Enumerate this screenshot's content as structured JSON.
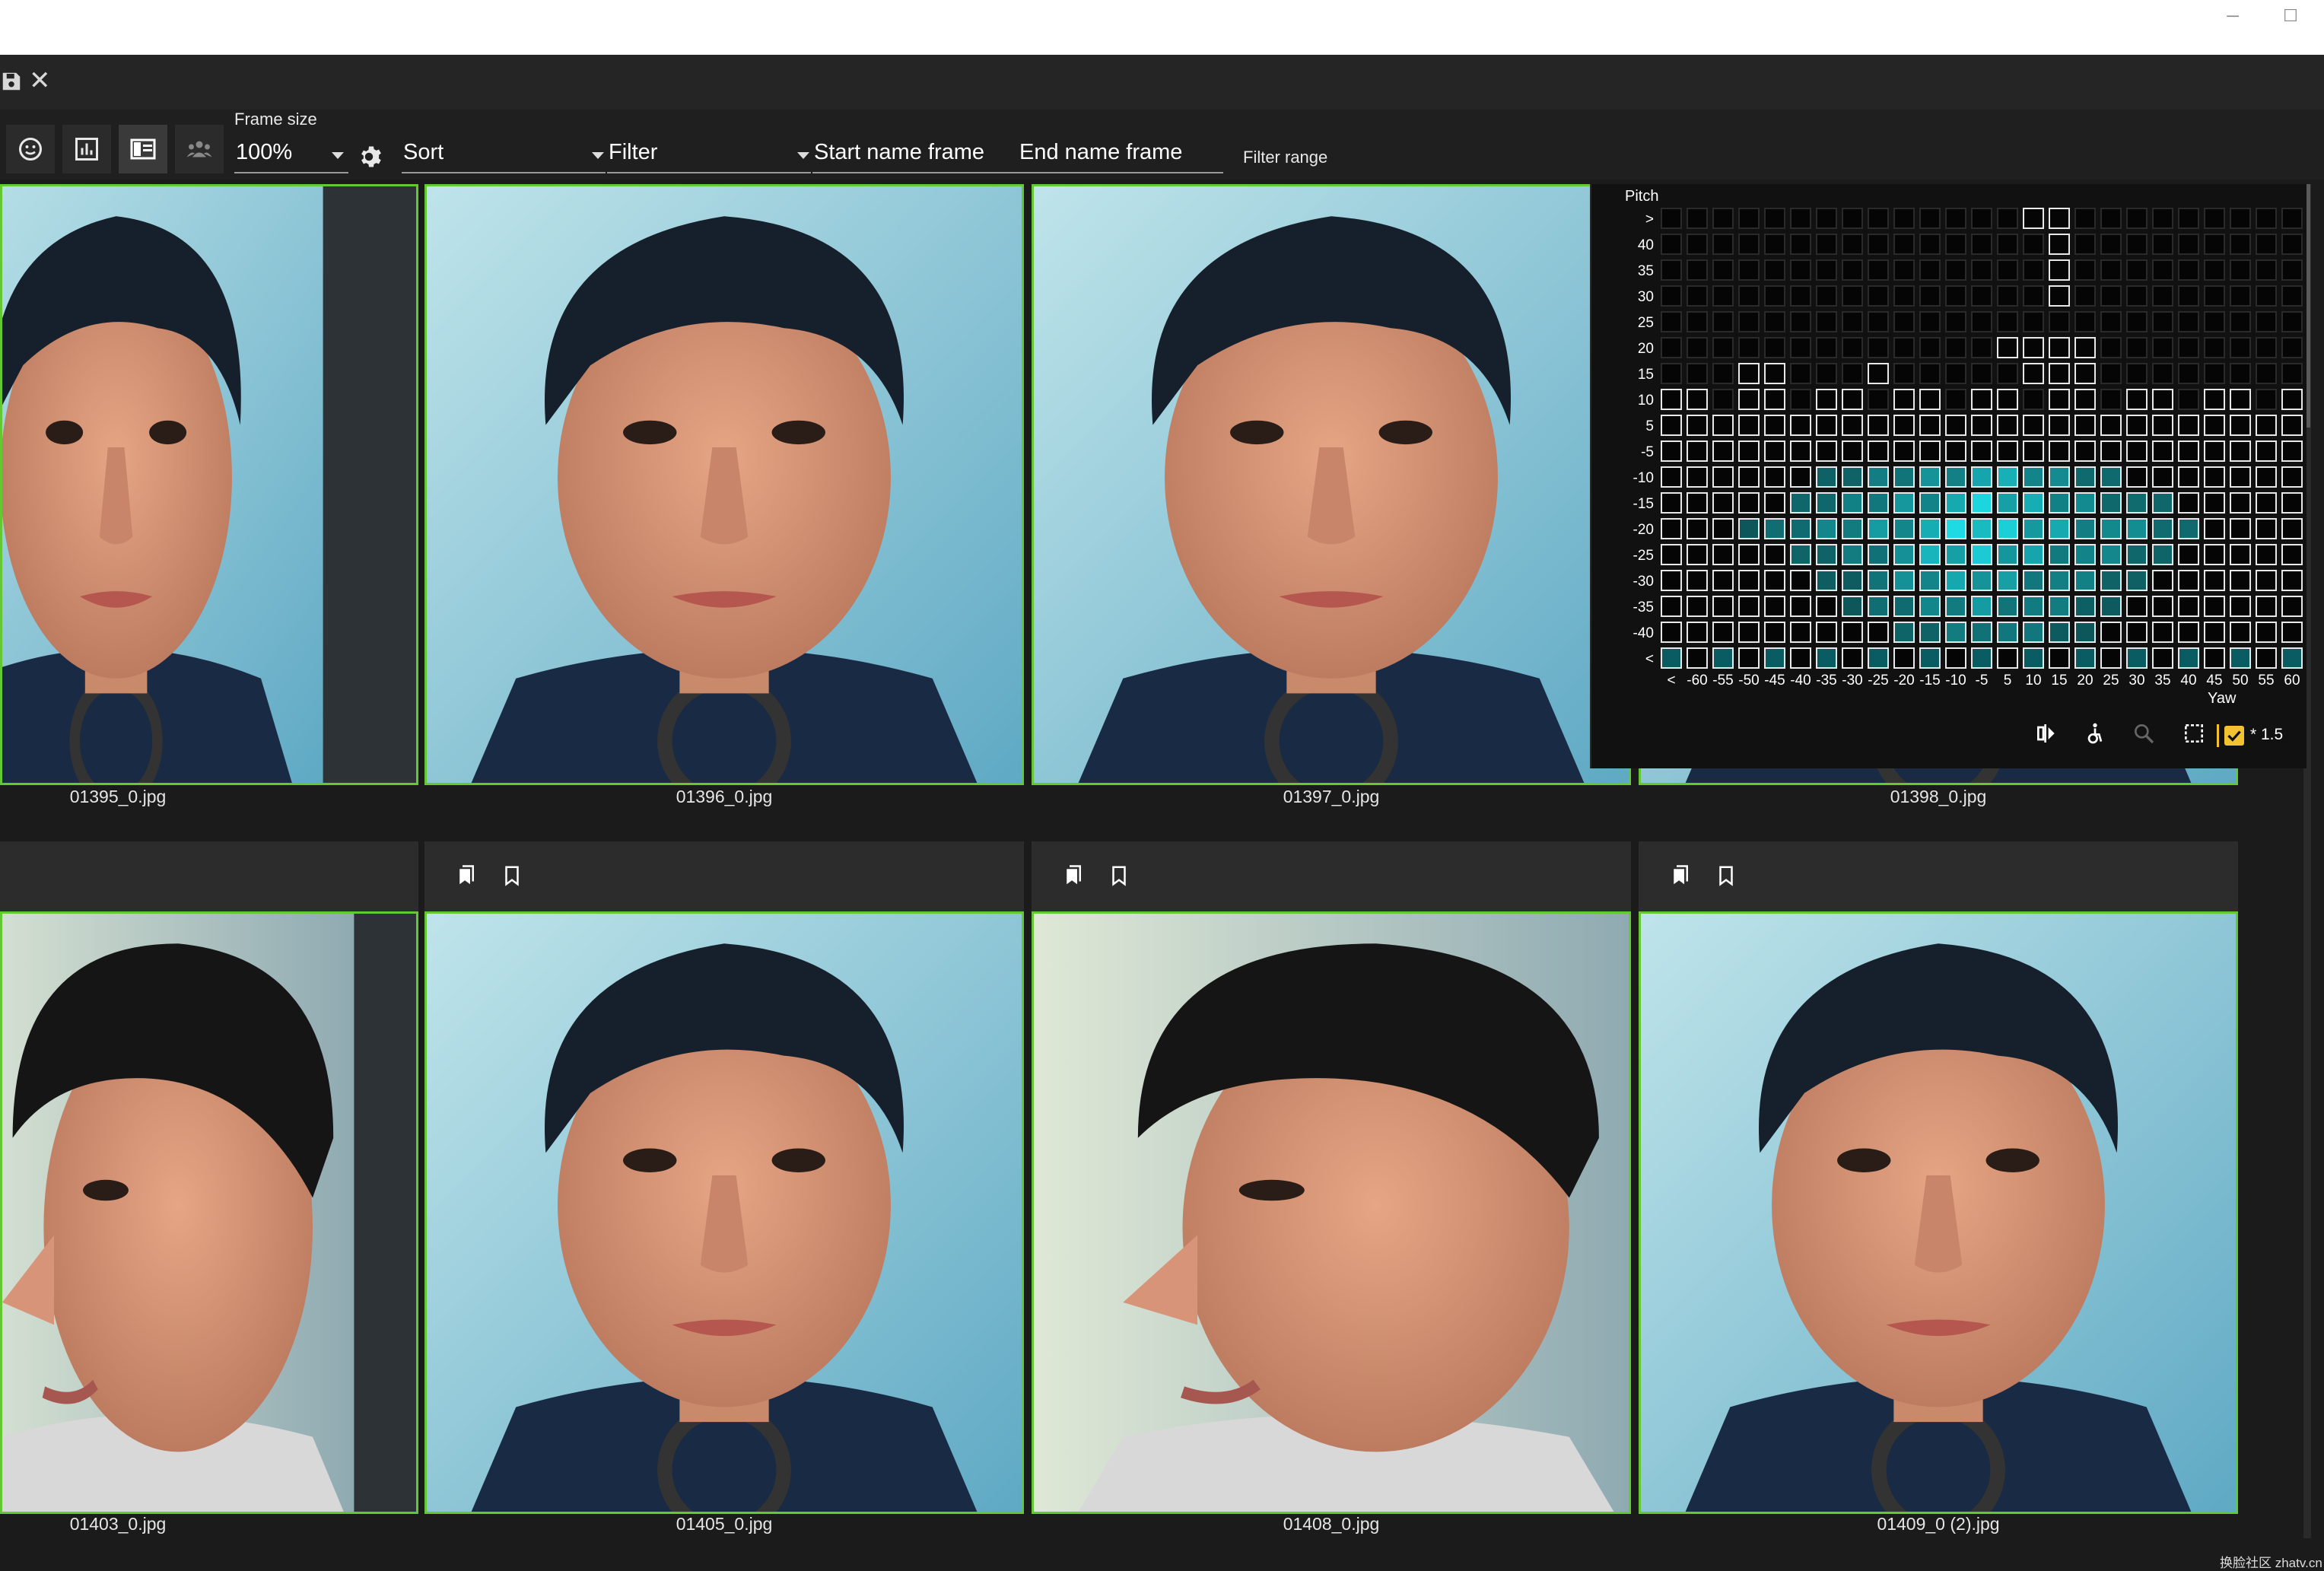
{
  "window": {
    "minimize_glyph": "─",
    "maximize_glyph": "☐"
  },
  "tabbar": {
    "save_icon": "save-icon",
    "close_glyph": "✕"
  },
  "toolbar": {
    "frame_size_label": "Frame size",
    "frame_size_value": "100%",
    "sort_label": "Sort",
    "filter_label": "Filter",
    "start_name_frame": "Start name frame",
    "end_name_frame": "End name frame",
    "filter_range": "Filter range",
    "icons": [
      "face-icon",
      "chart-icon",
      "layout-icon",
      "group-icon",
      "gear-icon"
    ]
  },
  "tiles_row1": [
    {
      "caption": "01395_0.jpg"
    },
    {
      "caption": "01396_0.jpg"
    },
    {
      "caption": "01397_0.jpg"
    },
    {
      "caption": "01398_0.jpg"
    }
  ],
  "tiles_row2": [
    {
      "caption": "01403_0.jpg"
    },
    {
      "caption": "01405_0.jpg"
    },
    {
      "caption": "01408_0.jpg"
    },
    {
      "caption": "01409_0 (2).jpg"
    }
  ],
  "histogram": {
    "pitch_label": "Pitch",
    "yaw_label": "Yaw",
    "pitch_ticks": [
      ">",
      "40",
      "35",
      "30",
      "25",
      "20",
      "15",
      "10",
      "5",
      "-5",
      "-10",
      "-15",
      "-20",
      "-25",
      "-30",
      "-35",
      "-40",
      "<"
    ],
    "yaw_ticks": [
      "<",
      "-60",
      "-55",
      "-50",
      "-45",
      "-40",
      "-35",
      "-30",
      "-25",
      "-20",
      "-15",
      "-10",
      "-5",
      "5",
      "10",
      "15",
      "20",
      "25",
      "30",
      "35",
      "40",
      "45",
      "50",
      "55",
      "60"
    ],
    "multiplier": "* 1.5",
    "accent_color": "#1fd5e0",
    "checkbox_color": "#f2c230",
    "tools": [
      "mirror-icon",
      "accessibility-icon",
      "zoom-icon",
      "selection-icon"
    ]
  },
  "watermark": "换脸社区 zhatv.cn"
}
